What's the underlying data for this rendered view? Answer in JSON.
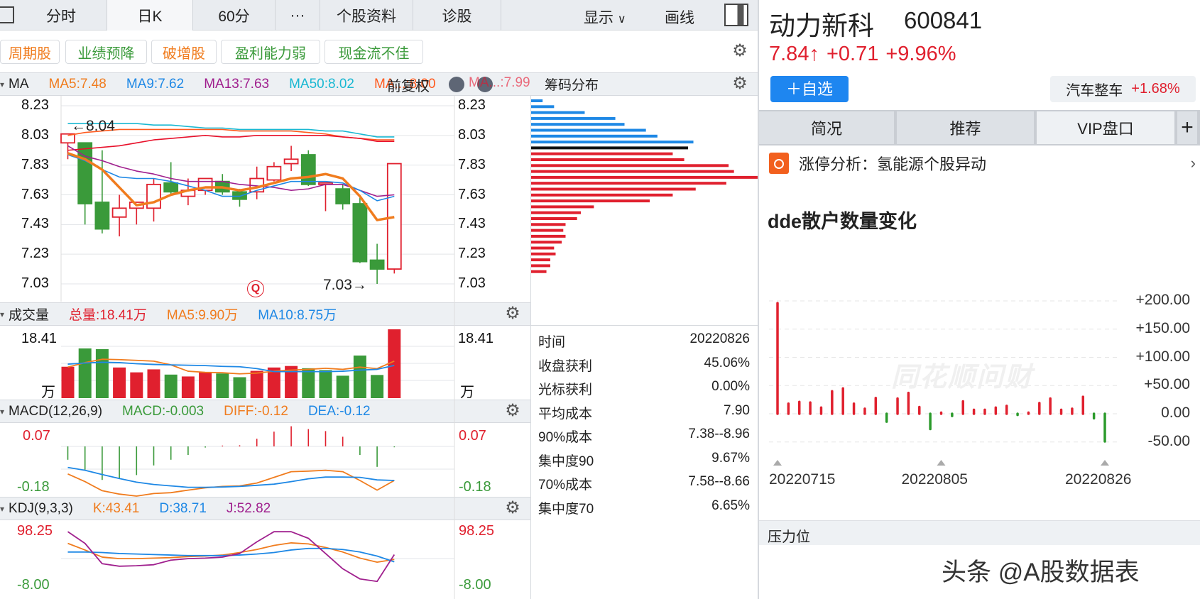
{
  "toolbar": {
    "tabs": [
      "分时",
      "日K",
      "60分",
      "···",
      "个股资料",
      "诊股"
    ],
    "active": 1,
    "display_label": "显示",
    "draw_label": "画线"
  },
  "tags": [
    {
      "label": "周期股",
      "color": "#f07c1e"
    },
    {
      "label": "业绩预降",
      "color": "#3a9a3a"
    },
    {
      "label": "破增股",
      "color": "#f07c1e"
    },
    {
      "label": "盈利能力弱",
      "color": "#3a9a3a"
    },
    {
      "label": "现金流不佳",
      "color": "#3a9a3a"
    }
  ],
  "ma_header": {
    "title": "MA",
    "items": [
      {
        "label": "MA5:7.48",
        "color": "#f07c1e"
      },
      {
        "label": "MA9:7.62",
        "color": "#1e88e5"
      },
      {
        "label": "MA13:7.63",
        "color": "#a0208e"
      },
      {
        "label": "MA50:8.02",
        "color": "#19b8d2"
      },
      {
        "label": "MA...:8.00",
        "color": "#ff5a1e"
      }
    ],
    "adjust": "前复权",
    "last_ma": "MA...:7.99"
  },
  "vol_header": {
    "title": "成交量",
    "items": [
      {
        "label": "总量:18.41万",
        "color": "#e0202e"
      },
      {
        "label": "MA5:9.90万",
        "color": "#f07c1e"
      },
      {
        "label": "MA10:8.75万",
        "color": "#1e88e5"
      }
    ]
  },
  "macd_header": {
    "title": "MACD(12,26,9)",
    "items": [
      {
        "label": "MACD:-0.003",
        "color": "#3a9a3a"
      },
      {
        "label": "DIFF:-0.12",
        "color": "#f07c1e"
      },
      {
        "label": "DEA:-0.12",
        "color": "#1e88e5"
      }
    ]
  },
  "kdj_header": {
    "title": "KDJ(9,3,3)",
    "items": [
      {
        "label": "K:43.41",
        "color": "#f07c1e"
      },
      {
        "label": "D:38.71",
        "color": "#1e88e5"
      },
      {
        "label": "J:52.82",
        "color": "#a0208e"
      }
    ]
  },
  "chip": {
    "title": "筹码分布",
    "rows": [
      {
        "label": "时间",
        "value": "20220826"
      },
      {
        "label": "收盘获利",
        "value": "45.06%"
      },
      {
        "label": "光标获利",
        "value": "0.00%"
      },
      {
        "label": "平均成本",
        "value": "7.90"
      },
      {
        "label": "90%成本",
        "value": "7.38--8.96"
      },
      {
        "label": "集中度90",
        "value": "9.67%"
      },
      {
        "label": "70%成本",
        "value": "7.58--8.66"
      },
      {
        "label": "集中度70",
        "value": "6.65%"
      }
    ],
    "distribution": [
      15,
      30,
      70,
      110,
      122,
      150,
      165,
      212,
      205,
      185,
      200,
      258,
      265,
      300,
      255,
      215,
      185,
      155,
      82,
      65,
      60,
      45,
      42,
      45,
      40,
      30,
      32,
      25,
      25,
      20
    ],
    "colors": [
      "blue",
      "blue",
      "blue",
      "blue",
      "blue",
      "blue",
      "blue",
      "blue",
      "black",
      "red",
      "red",
      "red",
      "red",
      "red",
      "red",
      "red",
      "red",
      "red",
      "red",
      "red",
      "red",
      "red",
      "red",
      "red",
      "red",
      "red",
      "red",
      "red",
      "red",
      "red"
    ]
  },
  "stock": {
    "name": "动力新科",
    "code": "600841",
    "price": "7.84↑",
    "change": "+0.71",
    "pct": "+9.96%",
    "watch_button": "＋自选",
    "sector": "汽车整车",
    "sector_pct": "+1.68%"
  },
  "right_tabs": [
    "简况",
    "推荐",
    "VIP盘口",
    "+"
  ],
  "news": {
    "text": "涨停分析：氢能源个股异动"
  },
  "dde": {
    "title": "dde散户数量变化",
    "watermark": "同花顺问财"
  },
  "pressure": "压力位",
  "footer_watermark": "头条 @A股数据表",
  "chart_data": [
    {
      "type": "candlestick",
      "name": "日K",
      "ylim": [
        7.03,
        8.23
      ],
      "yticks": [
        "8.23",
        "8.03",
        "7.83",
        "7.63",
        "7.43",
        "7.23",
        "7.03"
      ],
      "annotations": [
        "←8.04",
        "7.03→"
      ],
      "candles": [
        [
          7.98,
          8.04,
          8.04,
          7.87
        ],
        [
          7.98,
          7.57,
          7.98,
          7.43
        ],
        [
          7.58,
          7.4,
          7.93,
          7.37
        ],
        [
          7.48,
          7.54,
          7.63,
          7.35
        ],
        [
          7.54,
          7.58,
          7.58,
          7.43
        ],
        [
          7.54,
          7.7,
          7.74,
          7.45
        ],
        [
          7.71,
          7.65,
          7.85,
          7.63
        ],
        [
          7.62,
          7.66,
          7.74,
          7.56
        ],
        [
          7.66,
          7.74,
          7.74,
          7.63
        ],
        [
          7.72,
          7.65,
          7.77,
          7.63
        ],
        [
          7.65,
          7.6,
          7.67,
          7.55
        ],
        [
          7.65,
          7.74,
          7.82,
          7.6
        ],
        [
          7.73,
          7.82,
          7.85,
          7.72
        ],
        [
          7.84,
          7.87,
          7.96,
          7.79
        ],
        [
          7.9,
          7.7,
          7.93,
          7.69
        ],
        [
          7.7,
          7.71,
          7.71,
          7.52
        ],
        [
          7.67,
          7.57,
          7.7,
          7.53
        ],
        [
          7.57,
          7.18,
          7.61,
          7.17
        ],
        [
          7.19,
          7.13,
          7.3,
          7.03
        ],
        [
          7.13,
          7.84,
          7.84,
          7.1
        ]
      ],
      "lines": [
        {
          "color": "#19b8d2",
          "values": [
            8.11,
            8.11,
            8.11,
            8.11,
            8.11,
            8.1,
            8.1,
            8.09,
            8.08,
            8.08,
            8.07,
            8.07,
            8.07,
            8.07,
            8.07,
            8.06,
            8.06,
            8.04,
            8.02,
            8.02
          ]
        },
        {
          "color": "#ff5a1e",
          "values": [
            8.03,
            8.05,
            8.06,
            8.07,
            8.07,
            8.07,
            8.07,
            8.07,
            8.07,
            8.07,
            8.06,
            8.06,
            8.06,
            8.06,
            8.05,
            8.04,
            8.02,
            8.01,
            8.0,
            8.0
          ]
        },
        {
          "color": "#e8102a",
          "values": [
            7.93,
            7.94,
            7.95,
            7.96,
            7.98,
            8.0,
            8.01,
            8.02,
            8.03,
            8.02,
            8.02,
            8.03,
            8.03,
            8.03,
            8.03,
            8.03,
            8.02,
            8.01,
            7.99,
            7.99
          ]
        },
        {
          "color": "#a0208e",
          "values": [
            7.96,
            7.89,
            7.86,
            7.82,
            7.79,
            7.77,
            7.74,
            7.72,
            7.72,
            7.72,
            7.7,
            7.69,
            7.68,
            7.66,
            7.67,
            7.7,
            7.7,
            7.66,
            7.62,
            7.63
          ]
        },
        {
          "color": "#1e88e5",
          "values": [
            7.9,
            7.86,
            7.8,
            7.75,
            7.74,
            7.74,
            7.72,
            7.69,
            7.66,
            7.62,
            7.62,
            7.66,
            7.69,
            7.72,
            7.72,
            7.72,
            7.71,
            7.66,
            7.59,
            7.62
          ]
        },
        {
          "color": "#f07c1e",
          "width": 3.5,
          "values": [
            7.91,
            7.87,
            7.8,
            7.68,
            7.56,
            7.58,
            7.63,
            7.66,
            7.68,
            7.68,
            7.66,
            7.68,
            7.71,
            7.74,
            7.75,
            7.77,
            7.74,
            7.62,
            7.46,
            7.48
          ]
        }
      ]
    },
    {
      "type": "bar",
      "name": "成交量",
      "unit": "万",
      "ylim": [
        0,
        18.41
      ],
      "yticks": [
        "18.41",
        "万"
      ],
      "values": [
        8.4,
        13.3,
        13.1,
        8.2,
        6.9,
        7.7,
        6.3,
        5.8,
        6.9,
        6.6,
        5.6,
        7.3,
        8.2,
        8.6,
        8.0,
        7.5,
        6.0,
        11.4,
        6.2,
        18.41
      ],
      "colors": [
        "r",
        "g",
        "g",
        "r",
        "r",
        "r",
        "g",
        "r",
        "r",
        "g",
        "g",
        "r",
        "r",
        "r",
        "g",
        "g",
        "g",
        "g",
        "g",
        "r"
      ],
      "lines": [
        {
          "color": "#f07c1e",
          "values": [
            8.3,
            9.5,
            10.4,
            10.3,
            10.1,
            9.9,
            8.9,
            7.2,
            6.9,
            6.8,
            6.5,
            6.7,
            7.2,
            7.5,
            7.7,
            8.0,
            7.7,
            8.3,
            7.9,
            9.9
          ]
        },
        {
          "color": "#1e88e5",
          "values": [
            9.1,
            9.4,
            9.6,
            9.5,
            9.2,
            9.0,
            8.9,
            8.8,
            8.7,
            8.5,
            8.4,
            7.9,
            7.1,
            7.1,
            7.1,
            7.1,
            7.2,
            7.5,
            7.7,
            8.75
          ]
        }
      ]
    },
    {
      "type": "bar",
      "name": "MACD",
      "yticks": [
        "0.07",
        "-0.18"
      ],
      "values": [
        -0.047,
        -0.082,
        -0.118,
        -0.112,
        -0.101,
        -0.067,
        -0.047,
        -0.03,
        -0.004,
        0.003,
        0.004,
        0.027,
        0.052,
        0.071,
        0.061,
        0.054,
        0.034,
        -0.03,
        -0.072,
        -0.003
      ],
      "lines": [
        {
          "color": "#f07c1e",
          "values": [
            -0.097,
            -0.124,
            -0.156,
            -0.168,
            -0.175,
            -0.166,
            -0.163,
            -0.154,
            -0.146,
            -0.141,
            -0.139,
            -0.129,
            -0.109,
            -0.089,
            -0.087,
            -0.084,
            -0.089,
            -0.12,
            -0.154,
            -0.12
          ]
        },
        {
          "color": "#1e88e5",
          "values": [
            -0.074,
            -0.084,
            -0.099,
            -0.113,
            -0.126,
            -0.134,
            -0.139,
            -0.144,
            -0.144,
            -0.143,
            -0.141,
            -0.137,
            -0.133,
            -0.124,
            -0.114,
            -0.108,
            -0.108,
            -0.109,
            -0.118,
            -0.12
          ]
        }
      ]
    },
    {
      "type": "line",
      "name": "KDJ",
      "ylim": [
        -8,
        98.25
      ],
      "yticks": [
        "98.25",
        "-8.00"
      ],
      "lines": [
        {
          "color": "#f07c1e",
          "values": [
            75,
            62,
            48,
            45,
            45,
            46,
            47,
            49,
            50,
            52,
            57,
            63,
            71,
            76,
            74,
            67,
            58,
            46,
            38,
            43.41
          ]
        },
        {
          "color": "#1e88e5",
          "values": [
            58,
            58,
            57,
            55,
            54,
            53,
            52,
            51,
            51,
            51,
            52,
            54,
            57,
            62,
            65,
            65,
            63,
            58,
            50,
            38.71
          ]
        },
        {
          "color": "#a0208e",
          "values": [
            98,
            75,
            35,
            30,
            31,
            33,
            42,
            45,
            46,
            48,
            55,
            78,
            98,
            98,
            85,
            55,
            25,
            5,
            0,
            52.82
          ]
        }
      ]
    },
    {
      "type": "bar",
      "name": "dde散户数量变化",
      "ylim": [
        -50,
        200
      ],
      "yticks": [
        "+200.00",
        "+150.00",
        "+100.00",
        "+50.00",
        "0.00",
        "-50.00"
      ],
      "xticks": [
        "20220715",
        "20220805",
        "20220826"
      ],
      "values": [
        196,
        18,
        21,
        20,
        11,
        40,
        45,
        18,
        9,
        28,
        -14,
        27,
        37,
        12,
        -27,
        2,
        -4,
        22,
        7,
        7,
        11,
        14,
        -2,
        2,
        19,
        27,
        7,
        9,
        30,
        -8,
        -49
      ],
      "colors": {
        "up": "#e0202e",
        "down": "#2a9a2a"
      }
    }
  ]
}
